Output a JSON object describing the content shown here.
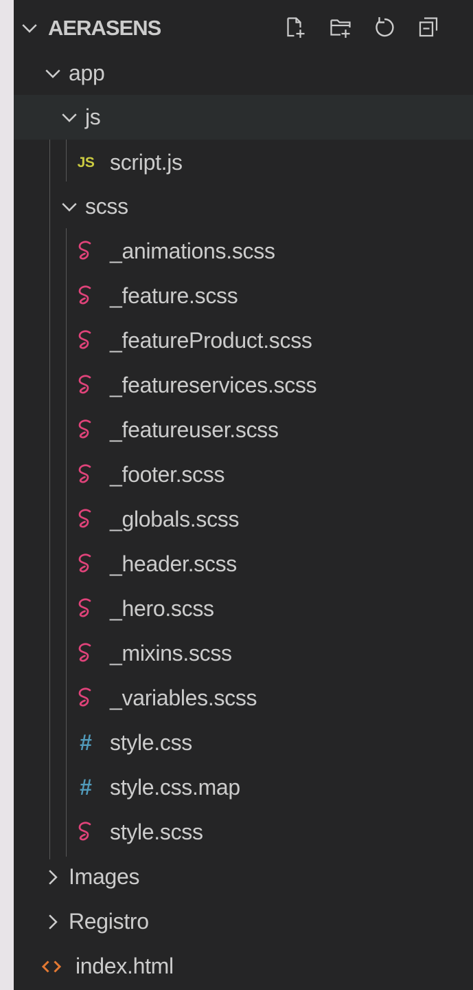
{
  "explorer": {
    "title": "AERASENS",
    "actions": [
      {
        "name": "new-file-icon"
      },
      {
        "name": "new-folder-icon"
      },
      {
        "name": "refresh-icon"
      },
      {
        "name": "collapse-all-icon"
      }
    ]
  },
  "tree": {
    "app": "app",
    "js": "js",
    "script_js": "script.js",
    "js_badge": "JS",
    "scss": "scss",
    "scss_files": [
      "_animations.scss",
      "_feature.scss",
      "_featureProduct.scss",
      "_featureservices.scss",
      "_featureuser.scss",
      "_footer.scss",
      "_globals.scss",
      "_header.scss",
      "_hero.scss",
      "_mixins.scss",
      "_variables.scss"
    ],
    "style_css": "style.css",
    "style_css_map": "style.css.map",
    "style_scss": "style.scss",
    "hash_badge": "#",
    "images": "Images",
    "registro": "Registro",
    "index_html": "index.html"
  },
  "colors": {
    "panel_bg": "#252526",
    "text": "#cccccc",
    "sass": "#e0437a",
    "js": "#cbcb41",
    "css": "#519aba",
    "html": "#e37933"
  }
}
